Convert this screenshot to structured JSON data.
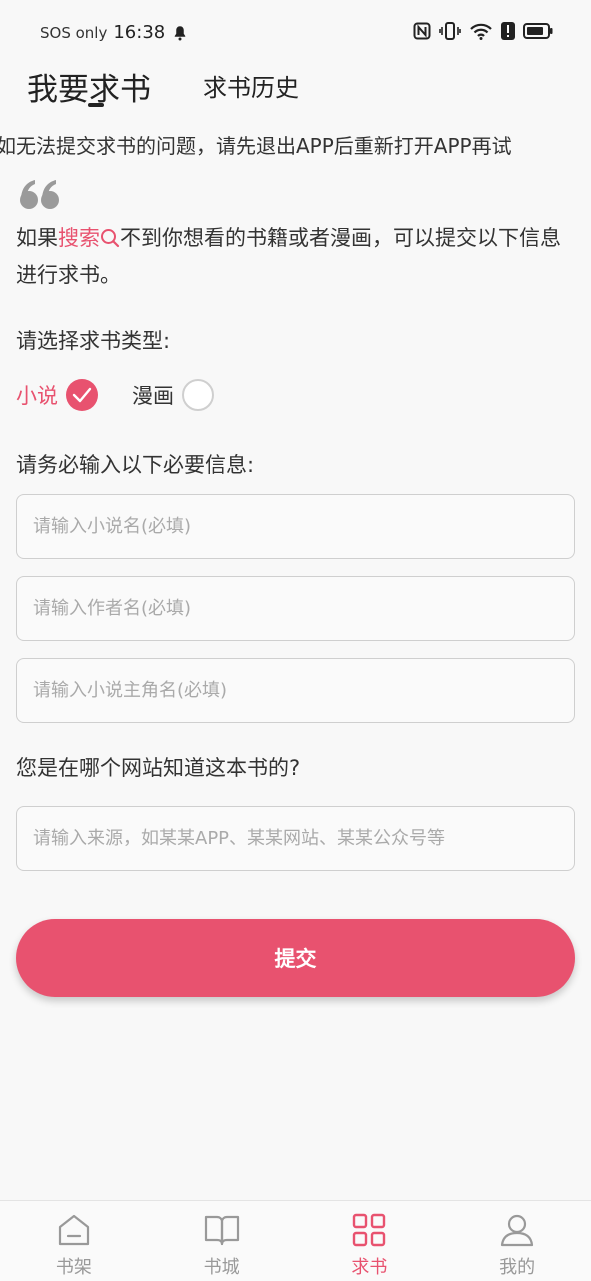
{
  "status_bar": {
    "carrier": "SOS only",
    "time": "16:38"
  },
  "tabs": [
    {
      "label": "我要求书",
      "active": true
    },
    {
      "label": "求书历史",
      "active": false
    }
  ],
  "notice": "如无法提交求书的问题，请先退出APP后重新打开APP再试",
  "intro": {
    "prefix": "如果",
    "highlight": "搜索",
    "suffix": "不到你想看的书籍或者漫画，可以提交以下信息进行求书。"
  },
  "type_label": "请选择求书类型:",
  "types": [
    {
      "label": "小说",
      "selected": true
    },
    {
      "label": "漫画",
      "selected": false
    }
  ],
  "required_label": "请务必输入以下必要信息:",
  "fields": {
    "book_name_placeholder": "请输入小说名(必填)",
    "author_placeholder": "请输入作者名(必填)",
    "protagonist_placeholder": "请输入小说主角名(必填)",
    "source_placeholder": "请输入来源，如某某APP、某某网站、某某公众号等"
  },
  "source_label": "您是在哪个网站知道这本书的?",
  "submit_label": "提交",
  "bottom_nav": [
    {
      "label": "书架",
      "icon": "home-icon",
      "active": false
    },
    {
      "label": "书城",
      "icon": "book-icon",
      "active": false
    },
    {
      "label": "求书",
      "icon": "grid-icon",
      "active": true
    },
    {
      "label": "我的",
      "icon": "person-icon",
      "active": false
    }
  ],
  "colors": {
    "accent": "#e8526f",
    "inactive": "#999999"
  }
}
